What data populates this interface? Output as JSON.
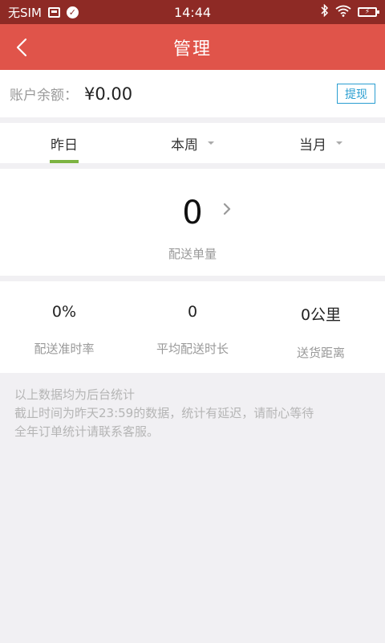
{
  "status_bar": {
    "carrier": "无SIM",
    "time": "14:44",
    "battery_icon": "battery-charging-icon"
  },
  "nav": {
    "title": "管理",
    "back_icon": "chevron-left-icon"
  },
  "balance": {
    "label": "账户余额：",
    "value": "¥0.00",
    "withdraw_label": "提现"
  },
  "tabs": [
    {
      "label": "昨日",
      "active": true,
      "has_dropdown": false
    },
    {
      "label": "本周",
      "active": false,
      "has_dropdown": true
    },
    {
      "label": "当月",
      "active": false,
      "has_dropdown": true
    }
  ],
  "orders": {
    "count": "0",
    "label": "配送单量"
  },
  "stats": [
    {
      "value": "0%",
      "label": "配送准时率"
    },
    {
      "value": "0",
      "label": "平均配送时长"
    },
    {
      "value": "0公里",
      "label": "送货距离"
    }
  ],
  "notes": [
    "以上数据均为后台统计",
    "截止时间为昨天23:59的数据，统计有延迟，请耐心等待",
    "全年订单统计请联系客服。"
  ],
  "colors": {
    "status_bar": "#8e2a25",
    "header": "#e0544a",
    "accent_green": "#7cb341",
    "link_blue": "#2a9ed1"
  }
}
